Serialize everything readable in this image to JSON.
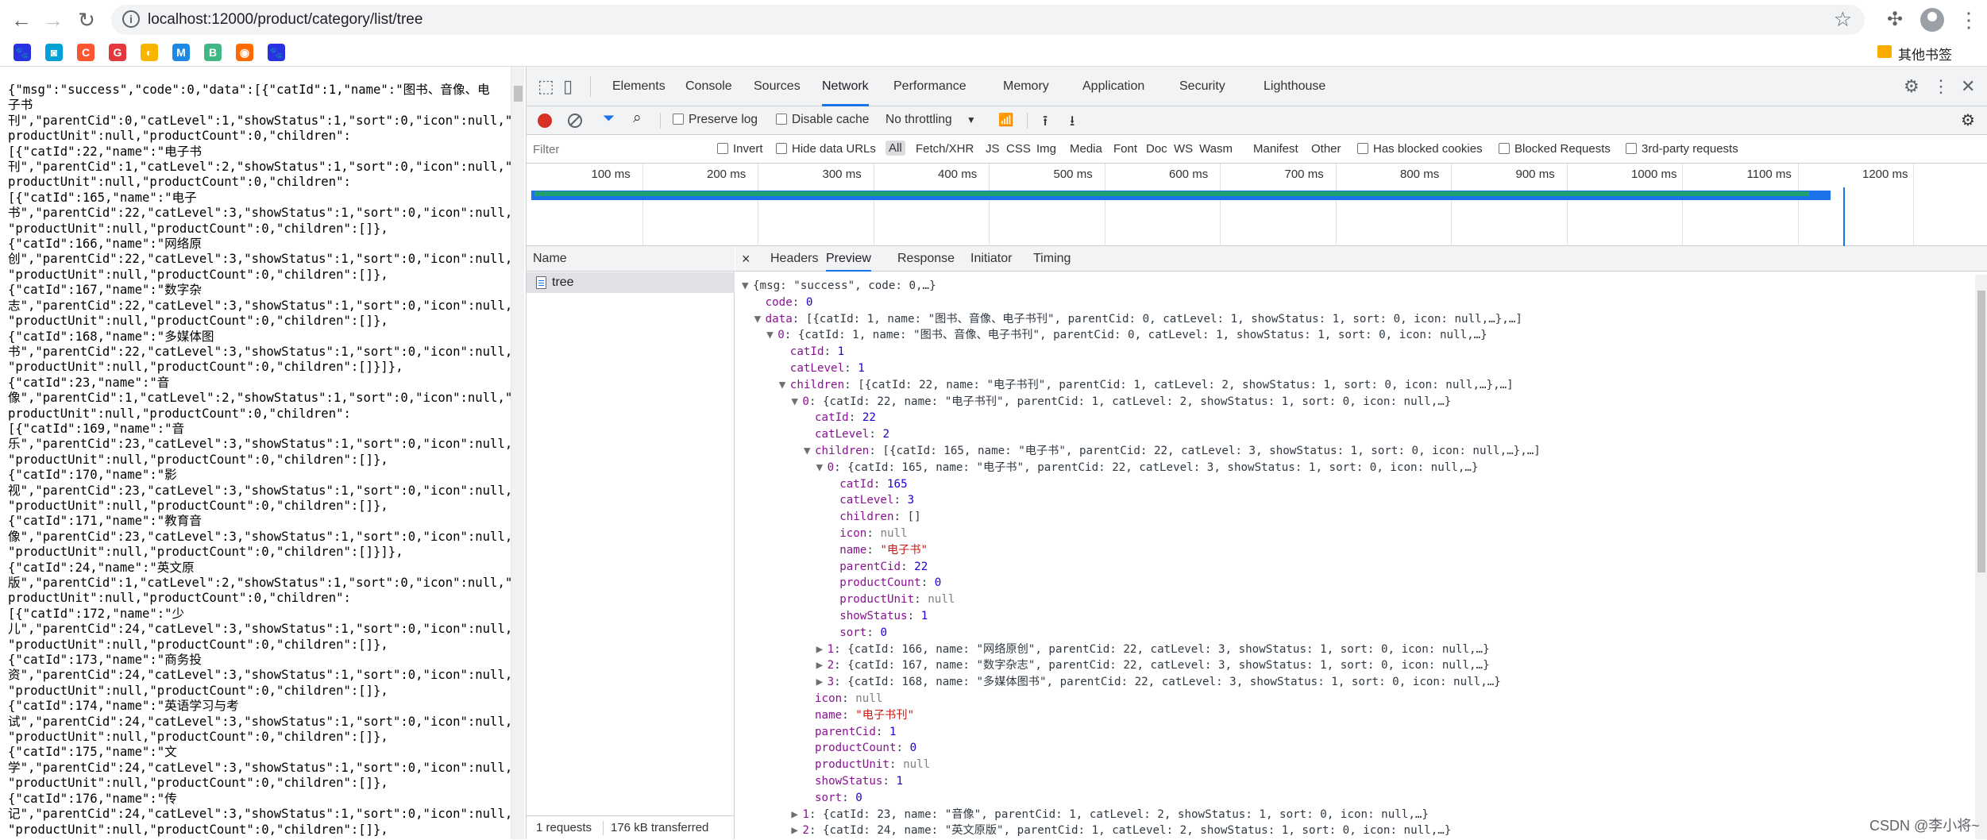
{
  "browser": {
    "url": "localhost:12000/product/category/list/tree",
    "other_bookmarks": "其他书签"
  },
  "bookmarks": [
    {
      "glyph": "🐾",
      "color": "#2932e1"
    },
    {
      "glyph": "◙",
      "color": "#00a1d6"
    },
    {
      "glyph": "C",
      "color": "#fc5531"
    },
    {
      "glyph": "G",
      "color": "#e4393c"
    },
    {
      "glyph": "◐",
      "color": "#f7b500"
    },
    {
      "glyph": "M",
      "color": "#1e88e5"
    },
    {
      "glyph": "B",
      "color": "#41b883"
    },
    {
      "glyph": "◉",
      "color": "#ff6a00"
    },
    {
      "glyph": "🐾",
      "color": "#2932e1"
    }
  ],
  "page_json_text": "{\"msg\":\"success\",\"code\":0,\"data\":[{\"catId\":1,\"name\":\"图书、音像、电\n子书\n刊\",\"parentCid\":0,\"catLevel\":1,\"showStatus\":1,\"sort\":0,\"icon\":null,\"\nproductUnit\":null,\"productCount\":0,\"children\":\n[{\"catId\":22,\"name\":\"电子书\n刊\",\"parentCid\":1,\"catLevel\":2,\"showStatus\":1,\"sort\":0,\"icon\":null,\"\nproductUnit\":null,\"productCount\":0,\"children\":\n[{\"catId\":165,\"name\":\"电子\n书\",\"parentCid\":22,\"catLevel\":3,\"showStatus\":1,\"sort\":0,\"icon\":null,\n\"productUnit\":null,\"productCount\":0,\"children\":[]},\n{\"catId\":166,\"name\":\"网络原\n创\",\"parentCid\":22,\"catLevel\":3,\"showStatus\":1,\"sort\":0,\"icon\":null,\n\"productUnit\":null,\"productCount\":0,\"children\":[]},\n{\"catId\":167,\"name\":\"数字杂\n志\",\"parentCid\":22,\"catLevel\":3,\"showStatus\":1,\"sort\":0,\"icon\":null,\n\"productUnit\":null,\"productCount\":0,\"children\":[]},\n{\"catId\":168,\"name\":\"多媒体图\n书\",\"parentCid\":22,\"catLevel\":3,\"showStatus\":1,\"sort\":0,\"icon\":null,\n\"productUnit\":null,\"productCount\":0,\"children\":[]}]},\n{\"catId\":23,\"name\":\"音\n像\",\"parentCid\":1,\"catLevel\":2,\"showStatus\":1,\"sort\":0,\"icon\":null,\"\nproductUnit\":null,\"productCount\":0,\"children\":\n[{\"catId\":169,\"name\":\"音\n乐\",\"parentCid\":23,\"catLevel\":3,\"showStatus\":1,\"sort\":0,\"icon\":null,\n\"productUnit\":null,\"productCount\":0,\"children\":[]},\n{\"catId\":170,\"name\":\"影\n视\",\"parentCid\":23,\"catLevel\":3,\"showStatus\":1,\"sort\":0,\"icon\":null,\n\"productUnit\":null,\"productCount\":0,\"children\":[]},\n{\"catId\":171,\"name\":\"教育音\n像\",\"parentCid\":23,\"catLevel\":3,\"showStatus\":1,\"sort\":0,\"icon\":null,\n\"productUnit\":null,\"productCount\":0,\"children\":[]}]},\n{\"catId\":24,\"name\":\"英文原\n版\",\"parentCid\":1,\"catLevel\":2,\"showStatus\":1,\"sort\":0,\"icon\":null,\"\nproductUnit\":null,\"productCount\":0,\"children\":\n[{\"catId\":172,\"name\":\"少\n儿\",\"parentCid\":24,\"catLevel\":3,\"showStatus\":1,\"sort\":0,\"icon\":null,\n\"productUnit\":null,\"productCount\":0,\"children\":[]},\n{\"catId\":173,\"name\":\"商务投\n资\",\"parentCid\":24,\"catLevel\":3,\"showStatus\":1,\"sort\":0,\"icon\":null,\n\"productUnit\":null,\"productCount\":0,\"children\":[]},\n{\"catId\":174,\"name\":\"英语学习与考\n试\",\"parentCid\":24,\"catLevel\":3,\"showStatus\":1,\"sort\":0,\"icon\":null,\n\"productUnit\":null,\"productCount\":0,\"children\":[]},\n{\"catId\":175,\"name\":\"文\n学\",\"parentCid\":24,\"catLevel\":3,\"showStatus\":1,\"sort\":0,\"icon\":null,\n\"productUnit\":null,\"productCount\":0,\"children\":[]},\n{\"catId\":176,\"name\":\"传\n记\",\"parentCid\":24,\"catLevel\":3,\"showStatus\":1,\"sort\":0,\"icon\":null,\n\"productUnit\":null,\"productCount\":0,\"children\":[]},",
  "devtools": {
    "tabs": [
      "Elements",
      "Console",
      "Sources",
      "Network",
      "Performance",
      "Memory",
      "Application",
      "Security",
      "Lighthouse"
    ],
    "active_tab": "Network",
    "toolbar": {
      "preserve_log": "Preserve log",
      "disable_cache": "Disable cache",
      "throttling": "No throttling"
    },
    "filter": {
      "placeholder": "Filter",
      "invert": "Invert",
      "hide_data_urls": "Hide data URLs",
      "types": [
        "All",
        "Fetch/XHR",
        "JS",
        "CSS",
        "Img",
        "Media",
        "Font",
        "Doc",
        "WS",
        "Wasm",
        "Manifest",
        "Other"
      ],
      "has_blocked_cookies": "Has blocked cookies",
      "blocked_requests": "Blocked Requests",
      "third_party": "3rd-party requests"
    },
    "timeline_ticks": [
      "100 ms",
      "200 ms",
      "300 ms",
      "400 ms",
      "500 ms",
      "600 ms",
      "700 ms",
      "800 ms",
      "900 ms",
      "1000 ms",
      "1100 ms",
      "1200 ms"
    ],
    "name_header": "Name",
    "request_name": "tree",
    "summary": {
      "requests": "1 requests",
      "transferred": "176 kB transferred"
    },
    "detail_tabs": [
      "Headers",
      "Preview",
      "Response",
      "Initiator",
      "Timing"
    ],
    "active_detail_tab": "Preview"
  },
  "preview_lines": [
    {
      "indent": 0,
      "tri": "▼",
      "parts": [
        [
          "p",
          "{msg: \"success\", code: 0,…}"
        ]
      ]
    },
    {
      "indent": 1,
      "tri": "",
      "parts": [
        [
          "k",
          "code"
        ],
        [
          "p",
          ": "
        ],
        [
          "n",
          "0"
        ]
      ]
    },
    {
      "indent": 1,
      "tri": "▼",
      "parts": [
        [
          "k",
          "data"
        ],
        [
          "p",
          ": [{catId: 1, name: \"图书、音像、电子书刊\", parentCid: 0, catLevel: 1, showStatus: 1, sort: 0, icon: null,…},…]"
        ]
      ]
    },
    {
      "indent": 2,
      "tri": "▼",
      "parts": [
        [
          "k",
          "0"
        ],
        [
          "p",
          ": {catId: 1, name: \"图书、音像、电子书刊\", parentCid: 0, catLevel: 1, showStatus: 1, sort: 0, icon: null,…}"
        ]
      ]
    },
    {
      "indent": 3,
      "tri": "",
      "parts": [
        [
          "k",
          "catId"
        ],
        [
          "p",
          ": "
        ],
        [
          "n",
          "1"
        ]
      ]
    },
    {
      "indent": 3,
      "tri": "",
      "parts": [
        [
          "k",
          "catLevel"
        ],
        [
          "p",
          ": "
        ],
        [
          "n",
          "1"
        ]
      ]
    },
    {
      "indent": 3,
      "tri": "▼",
      "parts": [
        [
          "k",
          "children"
        ],
        [
          "p",
          ": [{catId: 22, name: \"电子书刊\", parentCid: 1, catLevel: 2, showStatus: 1, sort: 0, icon: null,…},…]"
        ]
      ]
    },
    {
      "indent": 4,
      "tri": "▼",
      "parts": [
        [
          "k",
          "0"
        ],
        [
          "p",
          ": {catId: 22, name: \"电子书刊\", parentCid: 1, catLevel: 2, showStatus: 1, sort: 0, icon: null,…}"
        ]
      ]
    },
    {
      "indent": 5,
      "tri": "",
      "parts": [
        [
          "k",
          "catId"
        ],
        [
          "p",
          ": "
        ],
        [
          "n",
          "22"
        ]
      ]
    },
    {
      "indent": 5,
      "tri": "",
      "parts": [
        [
          "k",
          "catLevel"
        ],
        [
          "p",
          ": "
        ],
        [
          "n",
          "2"
        ]
      ]
    },
    {
      "indent": 5,
      "tri": "▼",
      "parts": [
        [
          "k",
          "children"
        ],
        [
          "p",
          ": [{catId: 165, name: \"电子书\", parentCid: 22, catLevel: 3, showStatus: 1, sort: 0, icon: null,…},…]"
        ]
      ]
    },
    {
      "indent": 6,
      "tri": "▼",
      "parts": [
        [
          "k",
          "0"
        ],
        [
          "p",
          ": {catId: 165, name: \"电子书\", parentCid: 22, catLevel: 3, showStatus: 1, sort: 0, icon: null,…}"
        ]
      ]
    },
    {
      "indent": 7,
      "tri": "",
      "parts": [
        [
          "k",
          "catId"
        ],
        [
          "p",
          ": "
        ],
        [
          "n",
          "165"
        ]
      ]
    },
    {
      "indent": 7,
      "tri": "",
      "parts": [
        [
          "k",
          "catLevel"
        ],
        [
          "p",
          ": "
        ],
        [
          "n",
          "3"
        ]
      ]
    },
    {
      "indent": 7,
      "tri": "",
      "parts": [
        [
          "k",
          "children"
        ],
        [
          "p",
          ": []"
        ]
      ]
    },
    {
      "indent": 7,
      "tri": "",
      "parts": [
        [
          "k",
          "icon"
        ],
        [
          "p",
          ": "
        ],
        [
          "nul",
          "null"
        ]
      ]
    },
    {
      "indent": 7,
      "tri": "",
      "parts": [
        [
          "k",
          "name"
        ],
        [
          "p",
          ": "
        ],
        [
          "s",
          "\"电子书\""
        ]
      ]
    },
    {
      "indent": 7,
      "tri": "",
      "parts": [
        [
          "k",
          "parentCid"
        ],
        [
          "p",
          ": "
        ],
        [
          "n",
          "22"
        ]
      ]
    },
    {
      "indent": 7,
      "tri": "",
      "parts": [
        [
          "k",
          "productCount"
        ],
        [
          "p",
          ": "
        ],
        [
          "n",
          "0"
        ]
      ]
    },
    {
      "indent": 7,
      "tri": "",
      "parts": [
        [
          "k",
          "productUnit"
        ],
        [
          "p",
          ": "
        ],
        [
          "nul",
          "null"
        ]
      ]
    },
    {
      "indent": 7,
      "tri": "",
      "parts": [
        [
          "k",
          "showStatus"
        ],
        [
          "p",
          ": "
        ],
        [
          "n",
          "1"
        ]
      ]
    },
    {
      "indent": 7,
      "tri": "",
      "parts": [
        [
          "k",
          "sort"
        ],
        [
          "p",
          ": "
        ],
        [
          "n",
          "0"
        ]
      ]
    },
    {
      "indent": 6,
      "tri": "▶",
      "parts": [
        [
          "k",
          "1"
        ],
        [
          "p",
          ": {catId: 166, name: \"网络原创\", parentCid: 22, catLevel: 3, showStatus: 1, sort: 0, icon: null,…}"
        ]
      ]
    },
    {
      "indent": 6,
      "tri": "▶",
      "parts": [
        [
          "k",
          "2"
        ],
        [
          "p",
          ": {catId: 167, name: \"数字杂志\", parentCid: 22, catLevel: 3, showStatus: 1, sort: 0, icon: null,…}"
        ]
      ]
    },
    {
      "indent": 6,
      "tri": "▶",
      "parts": [
        [
          "k",
          "3"
        ],
        [
          "p",
          ": {catId: 168, name: \"多媒体图书\", parentCid: 22, catLevel: 3, showStatus: 1, sort: 0, icon: null,…}"
        ]
      ]
    },
    {
      "indent": 5,
      "tri": "",
      "parts": [
        [
          "k",
          "icon"
        ],
        [
          "p",
          ": "
        ],
        [
          "nul",
          "null"
        ]
      ]
    },
    {
      "indent": 5,
      "tri": "",
      "parts": [
        [
          "k",
          "name"
        ],
        [
          "p",
          ": "
        ],
        [
          "s",
          "\"电子书刊\""
        ]
      ]
    },
    {
      "indent": 5,
      "tri": "",
      "parts": [
        [
          "k",
          "parentCid"
        ],
        [
          "p",
          ": "
        ],
        [
          "n",
          "1"
        ]
      ]
    },
    {
      "indent": 5,
      "tri": "",
      "parts": [
        [
          "k",
          "productCount"
        ],
        [
          "p",
          ": "
        ],
        [
          "n",
          "0"
        ]
      ]
    },
    {
      "indent": 5,
      "tri": "",
      "parts": [
        [
          "k",
          "productUnit"
        ],
        [
          "p",
          ": "
        ],
        [
          "nul",
          "null"
        ]
      ]
    },
    {
      "indent": 5,
      "tri": "",
      "parts": [
        [
          "k",
          "showStatus"
        ],
        [
          "p",
          ": "
        ],
        [
          "n",
          "1"
        ]
      ]
    },
    {
      "indent": 5,
      "tri": "",
      "parts": [
        [
          "k",
          "sort"
        ],
        [
          "p",
          ": "
        ],
        [
          "n",
          "0"
        ]
      ]
    },
    {
      "indent": 4,
      "tri": "▶",
      "parts": [
        [
          "k",
          "1"
        ],
        [
          "p",
          ": {catId: 23, name: \"音像\", parentCid: 1, catLevel: 2, showStatus: 1, sort: 0, icon: null,…}"
        ]
      ]
    },
    {
      "indent": 4,
      "tri": "▶",
      "parts": [
        [
          "k",
          "2"
        ],
        [
          "p",
          ": {catId: 24, name: \"英文原版\", parentCid: 1, catLevel: 2, showStatus: 1, sort: 0, icon: null,…}"
        ]
      ]
    }
  ],
  "watermark": "CSDN @李小将~"
}
